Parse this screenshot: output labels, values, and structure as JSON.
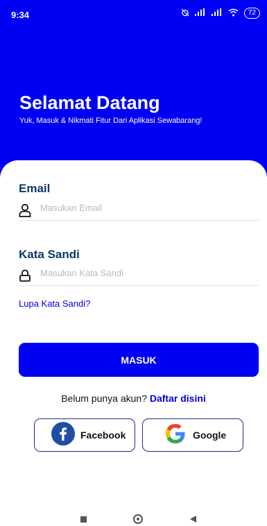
{
  "status_bar": {
    "time": "9:34",
    "battery": "72"
  },
  "header": {
    "title": "Selamat Datang",
    "subtitle": "Yuk, Masuk & Nikmati Fitur Dari Aplikasi Sewabarang!"
  },
  "form": {
    "email_label": "Email",
    "email_placeholder": "Masukan Email",
    "password_label": "Kata Sandi",
    "password_placeholder": "Masukan Kata Sandi",
    "forgot_label": "Lupa Kata Sandi?",
    "submit_label": "MASUK"
  },
  "register": {
    "prompt": "Belum punya akun?",
    "link_label": "Daftar disini"
  },
  "social": {
    "facebook_label": "Facebook",
    "google_label": "Google"
  },
  "colors": {
    "primary": "#0000f5",
    "label": "#0d3b66",
    "link": "#0000d9",
    "facebook": "#1877f2"
  },
  "icons": [
    "user-icon",
    "lock-icon",
    "facebook-icon",
    "google-icon",
    "nav-recent-icon",
    "nav-home-icon",
    "nav-back-icon"
  ]
}
